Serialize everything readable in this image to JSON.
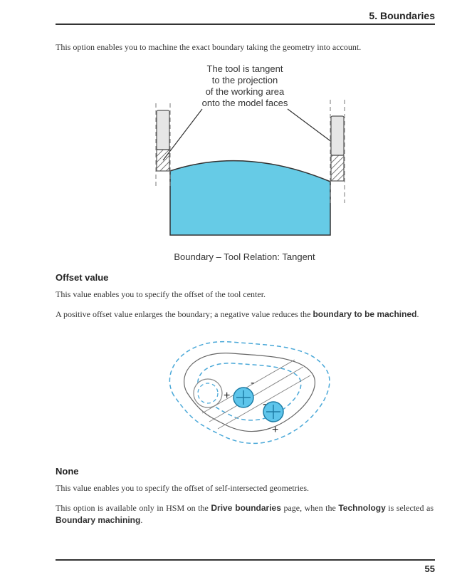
{
  "header": {
    "chapter": "5. Boundaries"
  },
  "intro": {
    "line": "This option enables you to machine the exact boundary taking the geometry into account."
  },
  "figure1": {
    "cap_line1": "The tool is tangent",
    "cap_line2": "to the projection",
    "cap_line3": "of the working area",
    "cap_line4": "onto the model faces",
    "caption": "Boundary – Tool Relation: Tangent"
  },
  "section_offset": {
    "heading": "Offset value",
    "p1": "This value enables you to specify the offset of the tool center.",
    "p2_a": "A positive offset value enlarges the boundary; a negative value reduces the ",
    "p2_b": "boundary to be machined",
    "p2_c": "."
  },
  "figure2": {
    "plus1": "+",
    "minus1": "-",
    "minus2": "-",
    "plus2": "+"
  },
  "section_none": {
    "heading": "None",
    "p1": "This value enables you to specify the offset of self-intersected geometries.",
    "p2_a": "This option is available only in HSM on the ",
    "p2_b": "Drive boundaries",
    "p2_c": " page, when the ",
    "p2_d": "Technology",
    "p2_e": " is selected as ",
    "p2_f": "Boundary machining",
    "p2_g": "."
  },
  "footer": {
    "page": "55"
  }
}
